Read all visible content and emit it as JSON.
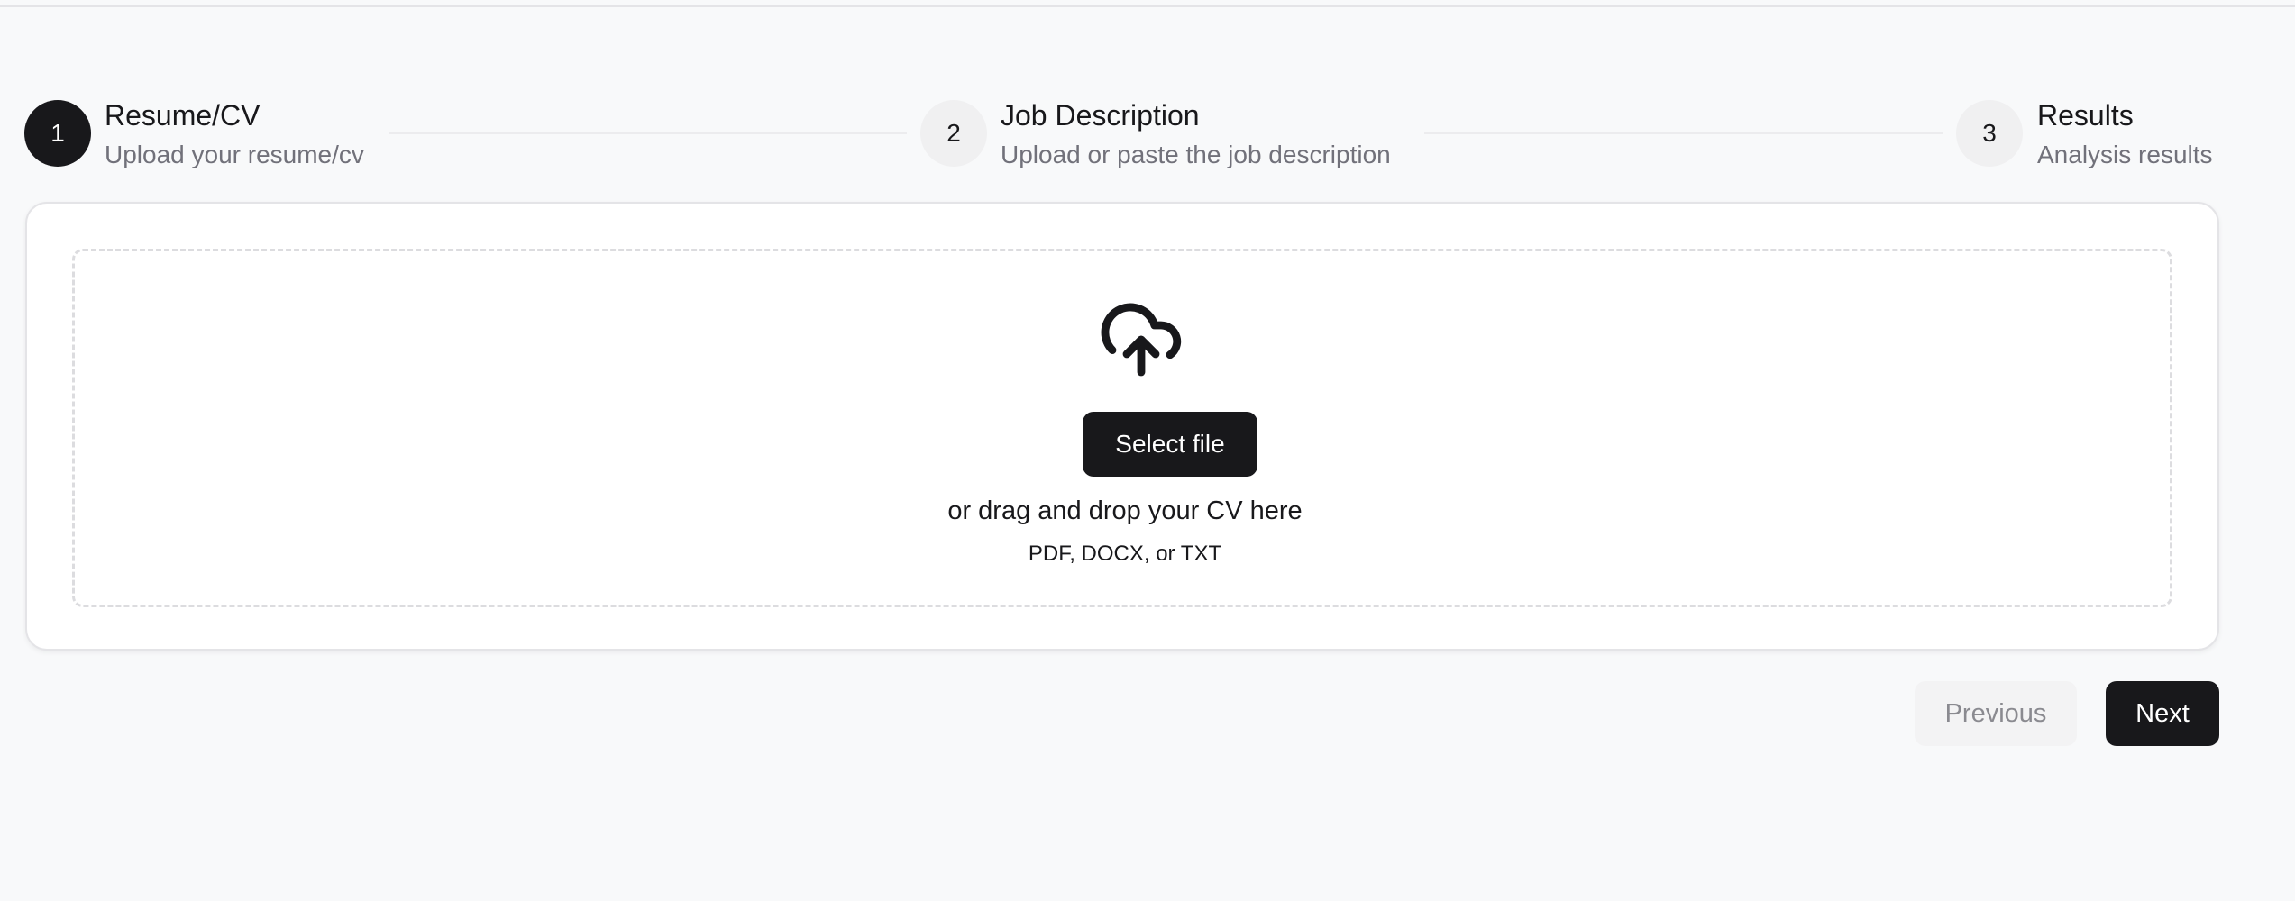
{
  "stepper": {
    "steps": [
      {
        "number": "1",
        "title": "Resume/CV",
        "subtitle": "Upload your resume/cv",
        "state": "active"
      },
      {
        "number": "2",
        "title": "Job Description",
        "subtitle": "Upload or paste the job description",
        "state": "upcoming"
      },
      {
        "number": "3",
        "title": "Results",
        "subtitle": "Analysis results",
        "state": "upcoming"
      }
    ]
  },
  "upload": {
    "icon": "cloud-upload-icon",
    "select_label": "Select file",
    "drop_hint": "or drag and drop your CV here",
    "formats": "PDF, DOCX, or TXT"
  },
  "navigation": {
    "previous_label": "Previous",
    "next_label": "Next"
  },
  "colors": {
    "primary": "#18181b",
    "muted_text": "#71717a",
    "background": "#f8f9fa",
    "card": "#ffffff"
  }
}
